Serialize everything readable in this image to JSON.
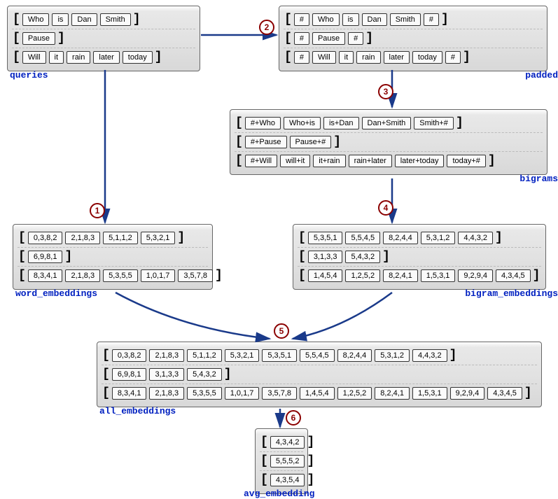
{
  "queries": {
    "label": "queries",
    "rows": [
      [
        "Who",
        "is",
        "Dan",
        "Smith"
      ],
      [
        "Pause"
      ],
      [
        "Will",
        "it",
        "rain",
        "later",
        "today"
      ]
    ]
  },
  "padded": {
    "label": "padded",
    "rows": [
      [
        "#",
        "Who",
        "is",
        "Dan",
        "Smith",
        "#"
      ],
      [
        "#",
        "Pause",
        "#"
      ],
      [
        "#",
        "Will",
        "it",
        "rain",
        "later",
        "today",
        "#"
      ]
    ]
  },
  "bigrams": {
    "label": "bigrams",
    "rows": [
      [
        "#+Who",
        "Who+is",
        "is+Dan",
        "Dan+Smith",
        "Smith+#"
      ],
      [
        "#+Pause",
        "Pause+#"
      ],
      [
        "#+Will",
        "will+it",
        "it+rain",
        "rain+later",
        "later+today",
        "today+#"
      ]
    ]
  },
  "word_embeddings": {
    "label": "word_embeddings",
    "rows": [
      [
        "0,3,8,2",
        "2,1,8,3",
        "5,1,1,2",
        "5,3,2,1"
      ],
      [
        "6,9,8,1"
      ],
      [
        "8,3,4,1",
        "2,1,8,3",
        "5,3,5,5",
        "1,0,1,7",
        "3,5,7,8"
      ]
    ]
  },
  "bigram_embeddings": {
    "label": "bigram_embeddings",
    "rows": [
      [
        "5,3,5,1",
        "5,5,4,5",
        "8,2,4,4",
        "5,3,1,2",
        "4,4,3,2"
      ],
      [
        "3,1,3,3",
        "5,4,3,2"
      ],
      [
        "1,4,5,4",
        "1,2,5,2",
        "8,2,4,1",
        "1,5,3,1",
        "9,2,9,4",
        "4,3,4,5"
      ]
    ]
  },
  "all_embeddings": {
    "label": "all_embeddings",
    "rows": [
      [
        "0,3,8,2",
        "2,1,8,3",
        "5,1,1,2",
        "5,3,2,1",
        "5,3,5,1",
        "5,5,4,5",
        "8,2,4,4",
        "5,3,1,2",
        "4,4,3,2"
      ],
      [
        "6,9,8,1",
        "3,1,3,3",
        "5,4,3,2"
      ],
      [
        "8,3,4,1",
        "2,1,8,3",
        "5,3,5,5",
        "1,0,1,7",
        "3,5,7,8",
        "1,4,5,4",
        "1,2,5,2",
        "8,2,4,1",
        "1,5,3,1",
        "9,2,9,4",
        "4,3,4,5"
      ]
    ]
  },
  "avg_embedding": {
    "label": "avg_embedding",
    "rows": [
      [
        "4,3,4,2"
      ],
      [
        "5,5,5,2"
      ],
      [
        "4,3,5,4"
      ]
    ]
  },
  "steps": {
    "s1": "1",
    "s2": "2",
    "s3": "3",
    "s4": "4",
    "s5": "5",
    "s6": "6"
  }
}
